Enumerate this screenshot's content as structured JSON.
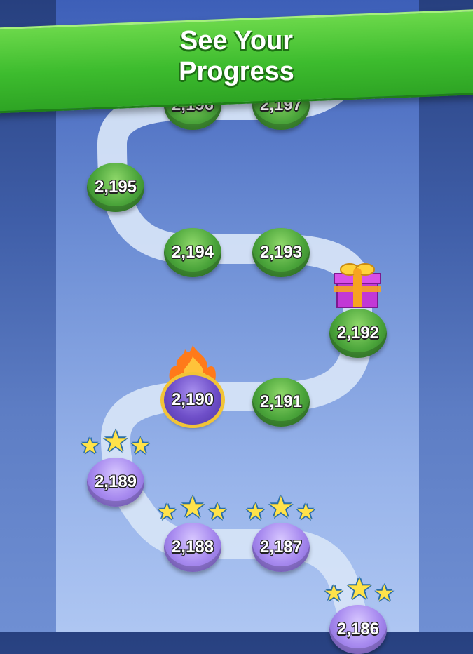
{
  "banner": {
    "line1": "See Your",
    "line2": "Progress"
  },
  "levels": [
    {
      "label": "2,196",
      "state": "locked"
    },
    {
      "label": "2,197",
      "state": "locked"
    },
    {
      "label": "2,195",
      "state": "locked"
    },
    {
      "label": "2,194",
      "state": "locked"
    },
    {
      "label": "2,193",
      "state": "locked"
    },
    {
      "label": "2,192",
      "state": "locked"
    },
    {
      "label": "2,191",
      "state": "locked"
    },
    {
      "label": "2,190",
      "state": "current"
    },
    {
      "label": "2,189",
      "state": "completed",
      "stars": 3
    },
    {
      "label": "2,188",
      "state": "completed",
      "stars": 3
    },
    {
      "label": "2,187",
      "state": "completed",
      "stars": 3
    },
    {
      "label": "2,186",
      "state": "completed",
      "stars": 3
    }
  ],
  "icons": {
    "reward": "gift-box-icon",
    "streak": "flame-icon",
    "rating": "star-icon"
  },
  "colors": {
    "banner": "#3dbc2e",
    "locked": "#4aa43a",
    "completed": "#a98cf0",
    "current_ring": "#f2c436"
  }
}
